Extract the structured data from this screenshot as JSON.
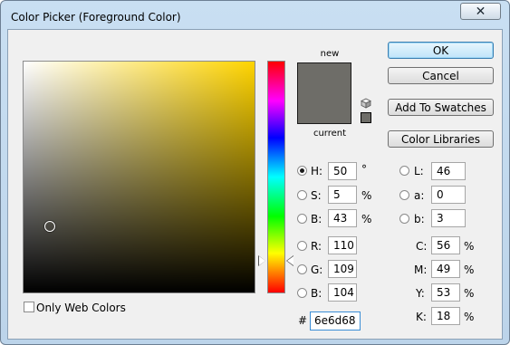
{
  "window": {
    "title": "Color Picker (Foreground Color)",
    "close_glyph": "✕"
  },
  "preview": {
    "new_label": "new",
    "current_label": "current",
    "color": "#6e6d68"
  },
  "buttons": {
    "ok": "OK",
    "cancel": "Cancel",
    "add_to_swatches": "Add To Swatches",
    "color_libraries": "Color Libraries"
  },
  "hsb": {
    "h": {
      "label": "H:",
      "value": "50",
      "unit": "°",
      "selected": true
    },
    "s": {
      "label": "S:",
      "value": "5",
      "unit": "%"
    },
    "b": {
      "label": "B:",
      "value": "43",
      "unit": "%"
    }
  },
  "rgb": {
    "r": {
      "label": "R:",
      "value": "110"
    },
    "g": {
      "label": "G:",
      "value": "109"
    },
    "b": {
      "label": "B:",
      "value": "104"
    }
  },
  "lab": {
    "l": {
      "label": "L:",
      "value": "46"
    },
    "a": {
      "label": "a:",
      "value": "0"
    },
    "b": {
      "label": "b:",
      "value": "3"
    }
  },
  "cmyk": {
    "c": {
      "label": "C:",
      "value": "56",
      "unit": "%"
    },
    "m": {
      "label": "M:",
      "value": "49",
      "unit": "%"
    },
    "y": {
      "label": "Y:",
      "value": "53",
      "unit": "%"
    },
    "k": {
      "label": "K:",
      "value": "18",
      "unit": "%"
    }
  },
  "hex": {
    "label": "#",
    "value": "6e6d68"
  },
  "web_colors": {
    "label": "Only Web Colors",
    "checked": false
  },
  "icons": {
    "gamut_warning": "cube-icon",
    "close": "close-icon"
  }
}
